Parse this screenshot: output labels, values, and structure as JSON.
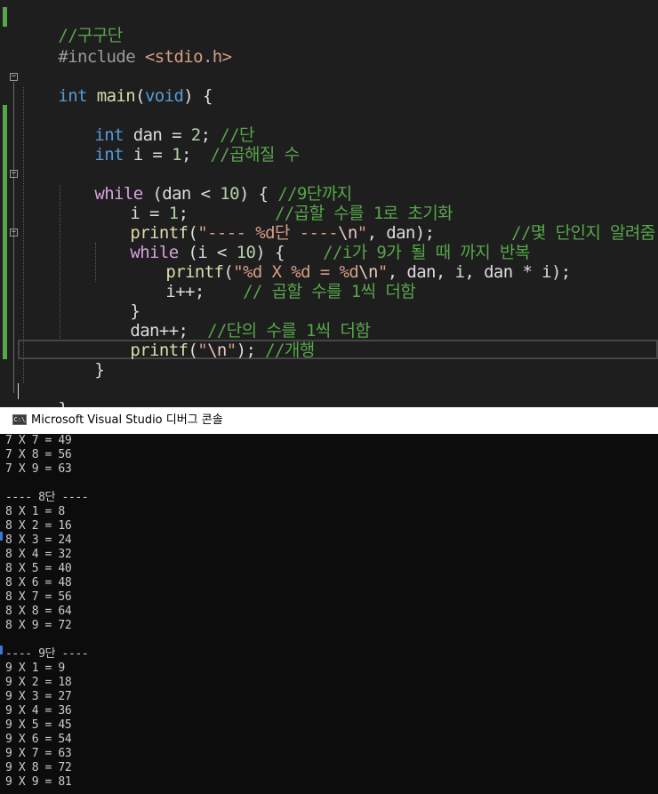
{
  "editor": {
    "lines": {
      "l1": {
        "comment": "//구구단"
      },
      "l2": {
        "directive": "#include",
        "header": "<stdio.h>"
      },
      "l4": {
        "type": "int",
        "name": "main",
        "params_open": "(",
        "param_type": "void",
        "rest": ") {"
      },
      "l6": {
        "type": "int",
        "code": " dan = ",
        "num": "2",
        "semi": "; ",
        "comment": "//단"
      },
      "l7": {
        "type": "int",
        "code": " i = ",
        "num": "1",
        "semi": ";  ",
        "comment": "//곱해질 수"
      },
      "l9": {
        "keyword": "while",
        "code": " (dan < ",
        "num": "10",
        "rest": ") { ",
        "comment": "//9단까지"
      },
      "l10": {
        "code": "i = ",
        "num": "1",
        "semi": ";         ",
        "comment": "//곱할 수를 1로 초기화"
      },
      "l11": {
        "fn": "printf",
        "open": "(",
        "str": "\"---- %d단 ----",
        "esc": "\\n",
        "str_end": "\"",
        "rest": ", dan);        ",
        "comment": "//몇 단인지 알려줌"
      },
      "l12": {
        "keyword": "while",
        "code": " (i < ",
        "num": "10",
        "rest": ") {    ",
        "comment": "//i가 9가 될 때 까지 반복"
      },
      "l13": {
        "fn": "printf",
        "open": "(",
        "str": "\"%d X %d = %d",
        "esc": "\\n",
        "str_end": "\"",
        "rest": ", dan, i, dan * i);"
      },
      "l14": {
        "code": "i++;    ",
        "comment": "// 곱할 수를 1씩 더함"
      },
      "l15": {
        "code": "}"
      },
      "l16": {
        "code": "dan++;  ",
        "comment": "//단의 수를 1씩 더함"
      },
      "l17": {
        "fn": "printf",
        "open": "(",
        "str": "\"",
        "esc": "\\n",
        "str_end": "\"",
        "rest": "); ",
        "comment": "//개행"
      },
      "l18": {
        "code": "}"
      },
      "l20": {
        "code": "}"
      }
    },
    "fold_glyph": "−"
  },
  "console": {
    "title": "Microsoft Visual Studio 디버그 콘솔",
    "icon_label": "C:\\",
    "lines": [
      "7 X 7 = 49",
      "7 X 8 = 56",
      "7 X 9 = 63",
      "",
      "---- 8단 ----",
      "8 X 1 = 8",
      "8 X 2 = 16",
      "8 X 3 = 24",
      "8 X 4 = 32",
      "8 X 5 = 40",
      "8 X 6 = 48",
      "8 X 7 = 56",
      "8 X 8 = 64",
      "8 X 9 = 72",
      "",
      "---- 9단 ----",
      "9 X 1 = 9",
      "9 X 2 = 18",
      "9 X 3 = 27",
      "9 X 4 = 36",
      "9 X 5 = 45",
      "9 X 6 = 54",
      "9 X 7 = 63",
      "9 X 8 = 72",
      "9 X 9 = 81"
    ]
  },
  "colors": {
    "editor_bg": "#1e1e1e",
    "comment": "#57a64a",
    "keyword": "#569cd6",
    "control": "#d8a0df",
    "string": "#d69d85",
    "number": "#b5cea8",
    "console_bg": "#0c0c0c",
    "console_text": "#cccccc"
  }
}
